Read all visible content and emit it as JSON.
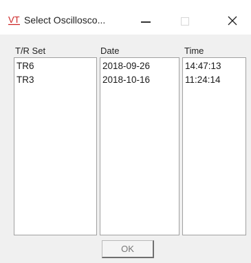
{
  "window": {
    "title": "Select Oscillosco...",
    "app_logo_text": "VT",
    "logo_color": "#cc2222",
    "controls": {
      "minimize_icon": "minimize-icon",
      "maximize_icon": "maximize-icon",
      "close_icon": "close-icon"
    }
  },
  "columns": {
    "trset": {
      "header": "T/R Set",
      "rows": [
        "TR6",
        "TR3"
      ]
    },
    "date": {
      "header": "Date",
      "rows": [
        "2018-09-26",
        "2018-10-16"
      ]
    },
    "time": {
      "header": "Time",
      "rows": [
        "14:47:13",
        "11:24:14"
      ]
    }
  },
  "ok_label": "OK"
}
